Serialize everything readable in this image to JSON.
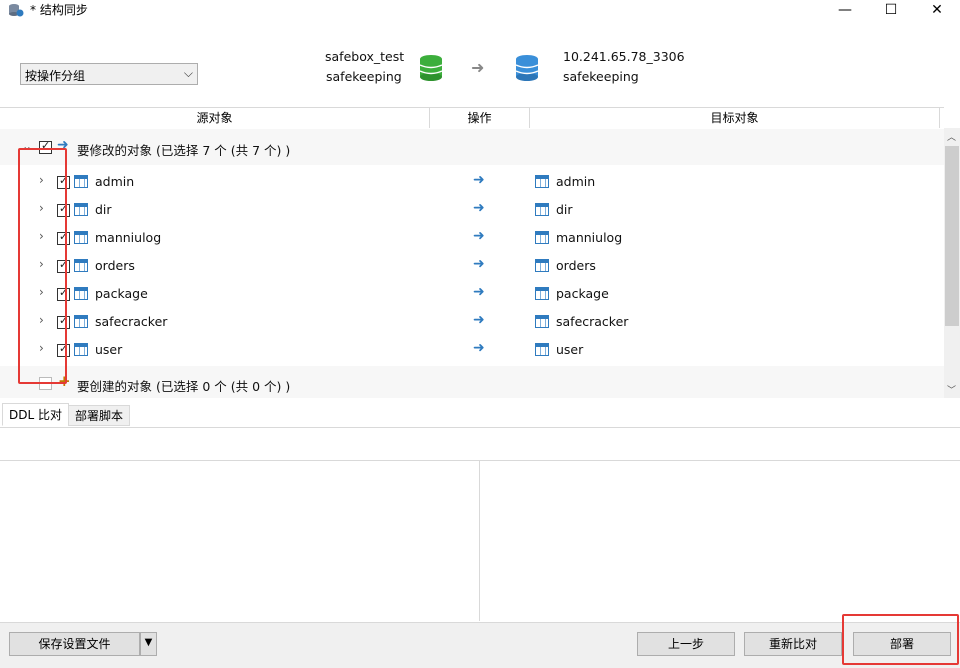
{
  "window": {
    "title": "* 结构同步",
    "minimize_glyph": "—",
    "maximize_glyph": "☐",
    "close_glyph": "✕"
  },
  "header": {
    "group_select": {
      "value": "按操作分组"
    },
    "source": {
      "connection": "safebox_test",
      "database": "safekeeping",
      "icon_color": "#3cae3c"
    },
    "arrow_glyph": "➜",
    "target": {
      "connection": "10.241.65.78_3306",
      "database": "safekeeping",
      "icon_color": "#3a8fd9"
    }
  },
  "grid": {
    "columns": [
      "源对象",
      "操作",
      "目标对象"
    ]
  },
  "tree": {
    "modify_group": {
      "label": "要修改的对象 (已选择 7 个 (共 7 个) )",
      "checked": true
    },
    "items": [
      {
        "source": "admin",
        "target": "admin",
        "checked": true
      },
      {
        "source": "dir",
        "target": "dir",
        "checked": true
      },
      {
        "source": "manniulog",
        "target": "manniulog",
        "checked": true
      },
      {
        "source": "orders",
        "target": "orders",
        "checked": true
      },
      {
        "source": "package",
        "target": "package",
        "checked": true
      },
      {
        "source": "safecracker",
        "target": "safecracker",
        "checked": true
      },
      {
        "source": "user",
        "target": "user",
        "checked": true
      }
    ],
    "create_group": {
      "label": "要创建的对象 (已选择 0 个 (共 0 个) )",
      "checked": false
    }
  },
  "tabs": [
    "DDL 比对",
    "部署脚本"
  ],
  "bottom": {
    "save_settings": "保存设置文件",
    "prev": "上一步",
    "recompare": "重新比对",
    "deploy": "部署"
  },
  "colors": {
    "accent": "#2f7bbf",
    "annotation": "#e53935"
  }
}
